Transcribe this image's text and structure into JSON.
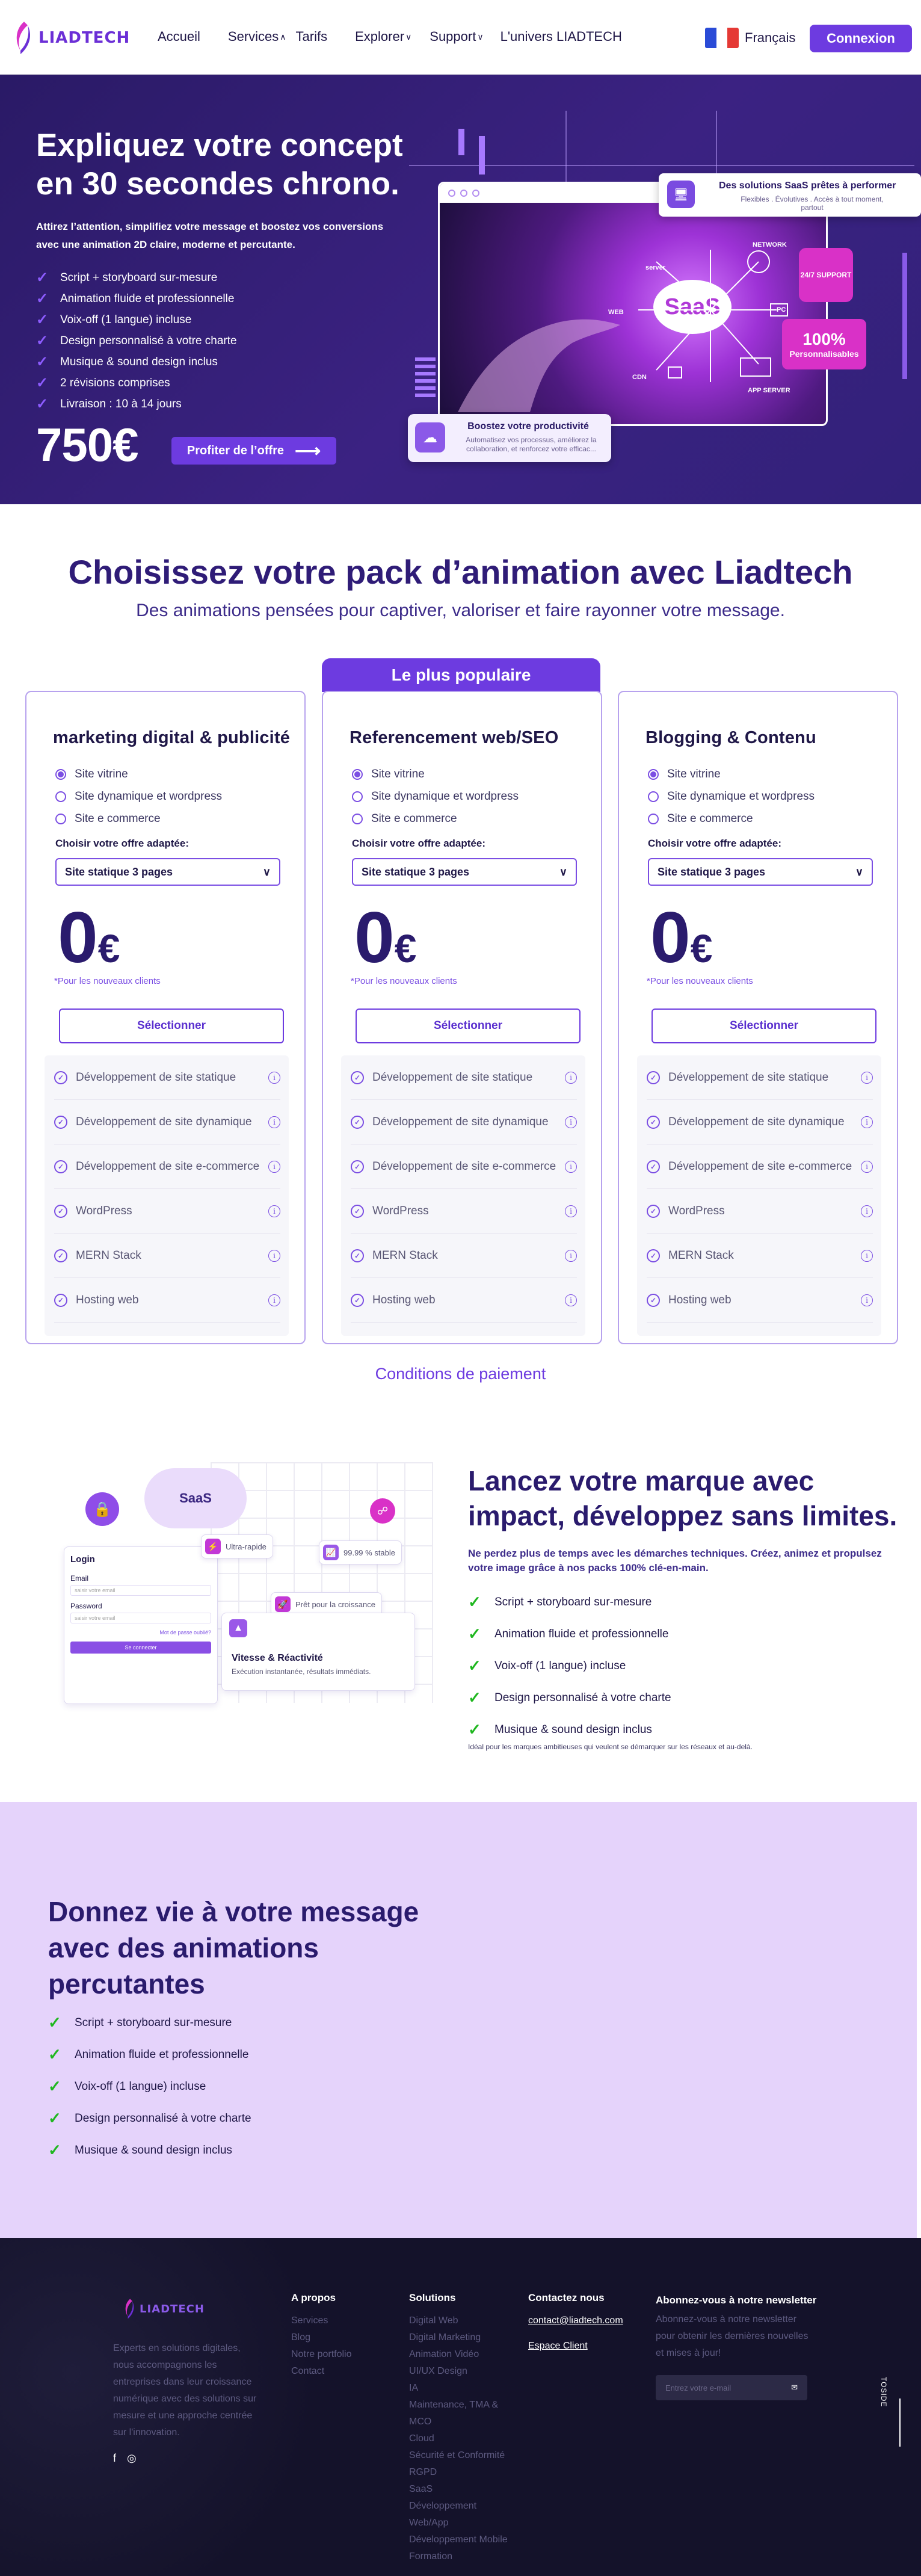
{
  "header": {
    "logo_text": "LIADTECH",
    "nav": [
      {
        "label": "Accueil",
        "dropdown": false
      },
      {
        "label": "Services",
        "dropdown": true
      },
      {
        "label": "Tarifs",
        "dropdown": false
      },
      {
        "label": "Explorer",
        "dropdown": true
      },
      {
        "label": "Support",
        "dropdown": true
      },
      {
        "label": "L'univers LIADTECH",
        "dropdown": false
      }
    ],
    "language": "Français",
    "login_label": "Connexion"
  },
  "hero": {
    "title": "Expliquez votre concept en 30 secondes chrono.",
    "subtitle": "Attirez l’attention, simplifiez votre message et boostez vos conversions avec une animation 2D claire, moderne et percutante.",
    "features": [
      "Script + storyboard sur-mesure",
      "Animation fluide et professionnelle",
      "Voix-off (1 langue) incluse",
      "Design personnalisé à votre charte",
      "Musique & sound design inclus",
      "2 révisions comprises",
      "Livraison : 10 à 14 jours"
    ],
    "price": "750€",
    "cta_label": "Profiter de l’offre",
    "visual": {
      "saas_label": "SaaS",
      "network_labels": [
        "NETWORK",
        "PC",
        "APP SERVER",
        "WEB",
        "CDN",
        "server"
      ],
      "card_title": "Des solutions SaaS prêtes à performer",
      "card_text": "Flexibles . Évolutives . Accès à tout moment, partout",
      "support_badge": "24/7 SUPPORT",
      "perso_big": "100%",
      "perso_small": "Personnalisables",
      "prod_title": "Boostez votre productivité",
      "prod_text": "Automatisez vos processus, améliorez la collaboration, et renforcez votre efficac..."
    }
  },
  "pricing": {
    "title": "Choisissez votre pack d’animation avec Liadtech",
    "subtitle": "Des animations pensées pour captiver, valoriser et faire rayonner votre message.",
    "popular_label": "Le plus populaire",
    "choose_label": "Choisir votre offre adaptée:",
    "select_value": "Site statique 3 pages",
    "price_value": "0",
    "currency": "€",
    "note": "*Pour les nouveaux clients",
    "button_label": "Sélectionner",
    "options": [
      "Site vitrine",
      "Site dynamique et wordpress",
      "Site e commerce"
    ],
    "features": [
      "Développement de site statique",
      "Développement de site dynamique",
      "Développement de site e-commerce",
      "WordPress",
      "MERN Stack",
      "Hosting web"
    ],
    "plans": [
      {
        "name": "marketing digital & publicité"
      },
      {
        "name": "Referencement web/SEO"
      },
      {
        "name": "Blogging & Contenu"
      }
    ],
    "conditions_label": "Conditions de paiement"
  },
  "brand": {
    "title": "Lancez votre marque avec impact, développez sans limites.",
    "subtitle": "Ne perdez plus de temps avec les démarches techniques. Créez, animez et propulsez votre image grâce à nos packs 100% clé-en-main.",
    "features": [
      "Script + storyboard sur-mesure",
      "Animation fluide et professionnelle",
      "Voix-off (1 langue) incluse",
      "Design personnalisé à votre charte",
      "Musique & sound design inclus"
    ],
    "footnote": "Idéal pour les marques ambitieuses qui veulent se démarquer sur les réseaux et au-delà.",
    "illustration": {
      "cloud_label": "SaaS",
      "login_title": "Login",
      "email_label": "Email",
      "email_placeholder": "saisir votre email",
      "password_label": "Password",
      "password_placeholder": "saisir votre email",
      "forgot": "Mot de passe oublié?",
      "login_btn": "Se connecter",
      "chip_fast": "Ultra-rapide",
      "chip_stable": "99.99 % stable",
      "chip_growth": "Prêt pour la croissance",
      "vit_title": "Vitesse & Réactivité",
      "vit_text": "Exécution instantanée, résultats immédiats."
    }
  },
  "lilac": {
    "title": "Donnez vie à votre message avec des animations percutantes",
    "features": [
      "Script + storyboard sur-mesure",
      "Animation fluide et professionnelle",
      "Voix-off (1 langue) incluse",
      "Design personnalisé à votre charte",
      "Musique & sound design inclus"
    ]
  },
  "footer": {
    "logo_text": "LIADTECH",
    "description": "Experts en solutions digitales, nous accompagnons les entreprises dans leur croissance numérique avec des solutions sur mesure et une approche centrée sur l'innovation.",
    "apropos": {
      "title": "A propos",
      "links": [
        "Services",
        "Blog",
        "Notre portfolio",
        "Contact"
      ]
    },
    "solutions": {
      "title": "Solutions",
      "links": [
        "Digital Web",
        "Digital Marketing",
        "Animation Vidéo",
        "UI/UX Design",
        "IA",
        "Maintenance, TMA & MCO",
        "Cloud",
        "Sécurité et Conformité RGPD",
        "SaaS",
        "Développement Web/App",
        "Développement Mobile",
        "Formation"
      ]
    },
    "contact": {
      "title": "Contactez nous",
      "email": "contact@liadtech.com",
      "space": "Espace Client"
    },
    "newsletter": {
      "title": "Abonnez-vous à notre newsletter",
      "text": "Abonnez-vous à notre newsletter pour obtenir les dernières nouvelles et mises à jour!",
      "placeholder": "Entrez votre e-mail"
    },
    "to_side": "TOSIDE"
  },
  "colors": {
    "primary": "#6d3be0",
    "hero_bg": "#2f1f70",
    "lilac": "#e5d3fb",
    "footer_bg": "#14122a",
    "check_green": "#1fb71f"
  }
}
